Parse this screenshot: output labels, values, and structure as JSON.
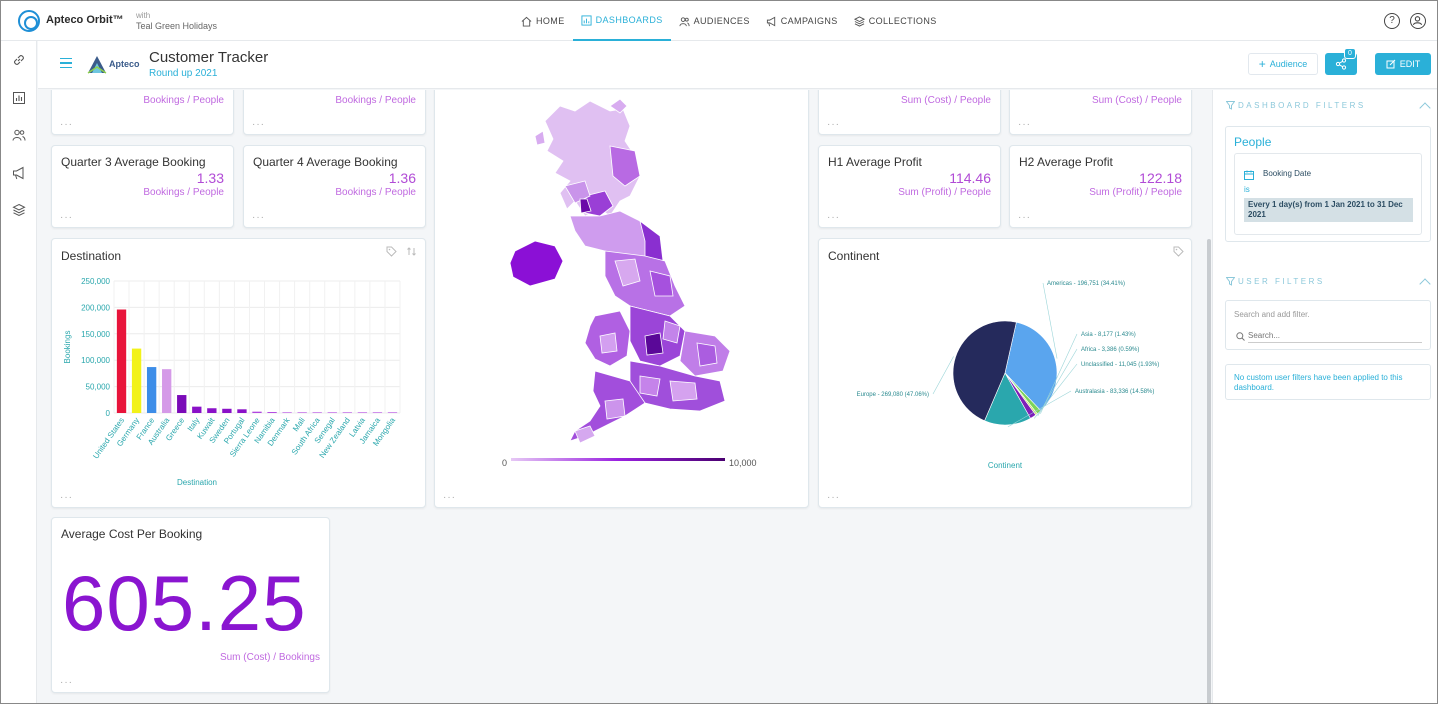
{
  "app": {
    "brand": "Apteco Orbit™",
    "with_label": "with",
    "org": "Teal Green Holidays"
  },
  "nav": [
    {
      "label": "HOME",
      "icon": "home-icon"
    },
    {
      "label": "DASHBOARDS",
      "icon": "dashboard-icon",
      "active": true
    },
    {
      "label": "AUDIENCES",
      "icon": "people-icon"
    },
    {
      "label": "CAMPAIGNS",
      "icon": "megaphone-icon"
    },
    {
      "label": "COLLECTIONS",
      "icon": "layers-icon"
    }
  ],
  "header": {
    "logo_text": "Apteco",
    "title": "Customer Tracker",
    "subtitle": "Round up 2021",
    "audience_button": "Audience",
    "share_count": "0",
    "edit_button": "EDIT"
  },
  "kpis": {
    "top_left_1": {
      "sub": "Bookings / People"
    },
    "top_left_2": {
      "sub": "Bookings / People"
    },
    "q3": {
      "title": "Quarter 3 Average Booking",
      "value": "1.33",
      "sub": "Bookings / People"
    },
    "q4": {
      "title": "Quarter 4 Average Booking",
      "value": "1.36",
      "sub": "Bookings / People"
    },
    "top_right_1": {
      "sub": "Sum (Cost) / People"
    },
    "top_right_2": {
      "sub": "Sum (Cost) / People"
    },
    "h1": {
      "title": "H1 Average Profit",
      "value": "114.46",
      "sub": "Sum (Profit) / People"
    },
    "h2": {
      "title": "H2 Average Profit",
      "value": "122.18",
      "sub": "Sum (Profit) / People"
    },
    "avg_cost": {
      "title": "Average Cost Per Booking",
      "value": "605.25",
      "sub": "Sum (Cost) / Bookings"
    }
  },
  "map": {
    "legend_min": "0",
    "legend_max": "10,000",
    "colors": {
      "low": "#e6c8f5",
      "high": "#4a0070"
    }
  },
  "chart_data": [
    {
      "type": "bar",
      "title": "Destination",
      "xlabel": "Destination",
      "ylabel": "Bookings",
      "ylim": [
        0,
        250000
      ],
      "yticks": [
        "0",
        "50,000",
        "100,000",
        "150,000",
        "200,000",
        "250,000"
      ],
      "grid": true,
      "categories": [
        "United States",
        "Germany",
        "France",
        "Australia",
        "Greece",
        "Italy",
        "Kuwait",
        "Sweden",
        "Portugal",
        "Sierra Leone",
        "Namibia",
        "Denmark",
        "Mali",
        "South Africa",
        "Senegal",
        "New Zealand",
        "Latvia",
        "Jamaica",
        "Mongolia"
      ],
      "values": [
        196000,
        122000,
        87000,
        83000,
        34000,
        12000,
        9000,
        8000,
        7000,
        2500,
        1800,
        500,
        300,
        200,
        150,
        100,
        80,
        60,
        50
      ],
      "colors": [
        "#e8133a",
        "#f2f21a",
        "#3c8de8",
        "#d59ae8",
        "#7a0ab8",
        "#8a11c8",
        "#8a11c8",
        "#8a11c8",
        "#8a11c8",
        "#b046e0",
        "#b046e0",
        "#b046e0",
        "#b046e0",
        "#b046e0",
        "#b046e0",
        "#b046e0",
        "#b046e0",
        "#b046e0",
        "#b046e0"
      ]
    },
    {
      "type": "pie",
      "title": "Continent",
      "xlabel": "Continent",
      "slices": [
        {
          "name": "Americas",
          "value": 196751,
          "label": "Americas - 196,751 (34.41%)",
          "color": "#5aa5ee"
        },
        {
          "name": "Asia",
          "value": 8177,
          "label": "Asia - 8,177 (1.43%)",
          "color": "#7cd45a"
        },
        {
          "name": "Africa",
          "value": 3386,
          "label": "Africa - 3,386 (0.59%)",
          "color": "#c9e26a"
        },
        {
          "name": "Unclassified",
          "value": 11045,
          "label": "Unclassified - 11,045 (1.93%)",
          "color": "#7e1fb8"
        },
        {
          "name": "Australasia",
          "value": 83336,
          "label": "Australasia - 83,336 (14.58%)",
          "color": "#2aa7ad"
        },
        {
          "name": "Europe",
          "value": 269080,
          "label": "Europe - 269,080 (47.06%)",
          "color": "#252a5c"
        }
      ]
    }
  ],
  "filters": {
    "dashboard_header": "DASHBOARD FILTERS",
    "group_title": "People",
    "filter_name": "Booking Date",
    "filter_op": "is",
    "filter_value": "Every 1 day(s) from 1 Jan 2021 to 31 Dec 2021",
    "user_header": "USER FILTERS",
    "search_hint": "Search and add filter.",
    "search_placeholder": "Search...",
    "empty_text": "No custom user filters have been applied to this dashboard."
  }
}
